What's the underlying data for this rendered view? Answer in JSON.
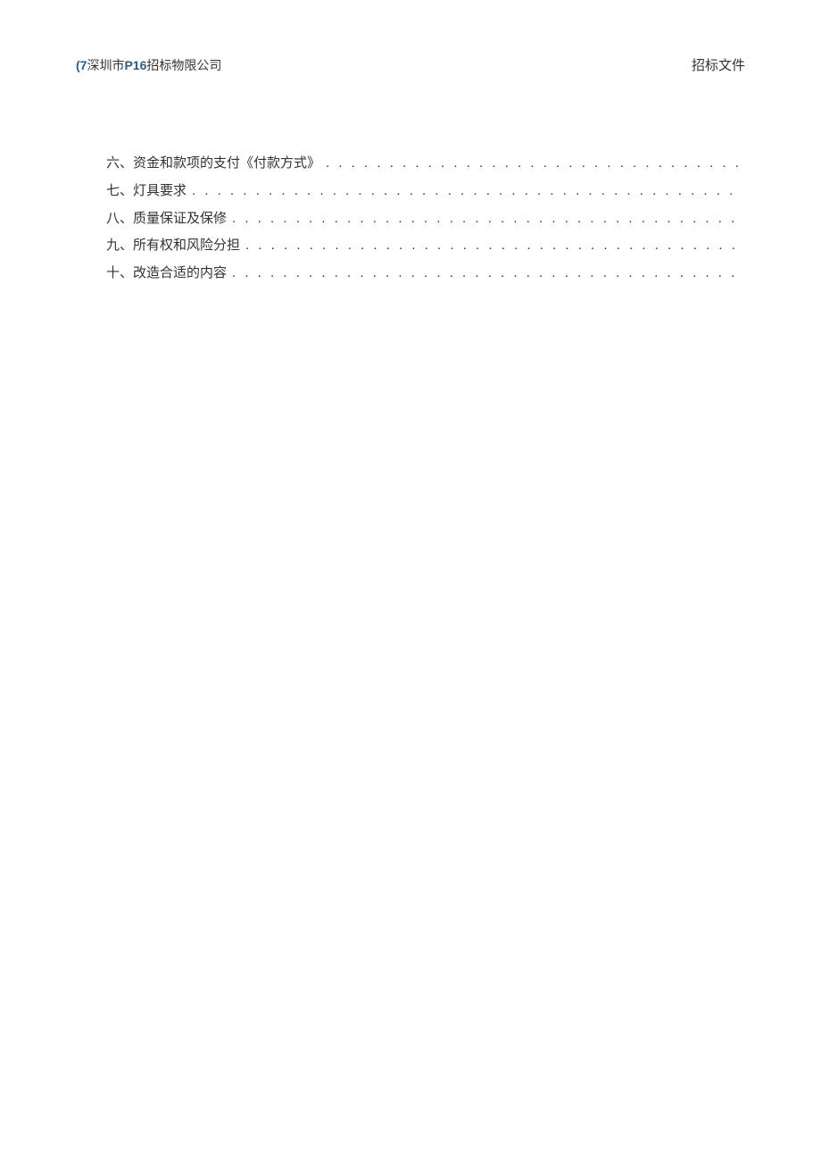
{
  "header": {
    "left_paren": "(",
    "left_num": "7",
    "left_text_1": "深圳市",
    "left_code": "P16",
    "left_text_2": "招标物限公司",
    "right": "招标文件"
  },
  "toc": [
    {
      "label": "六、资金和款项的支付《付款方式》"
    },
    {
      "label": "七、灯具要求"
    },
    {
      "label": "八、质量保证及保修"
    },
    {
      "label": "九、所有权和风险分担"
    },
    {
      "label": "十、改造合适的内容"
    }
  ],
  "dots": ". . . . . . . . . . . . . . . . . . . . . . . . . . . . . . . . . . . . . . . . . . . . . . . . . . . . . . . . . . . . . . . . . . . . . . . . . . . . . . . . . . . . . . . . . . . . . . . . . . . ."
}
